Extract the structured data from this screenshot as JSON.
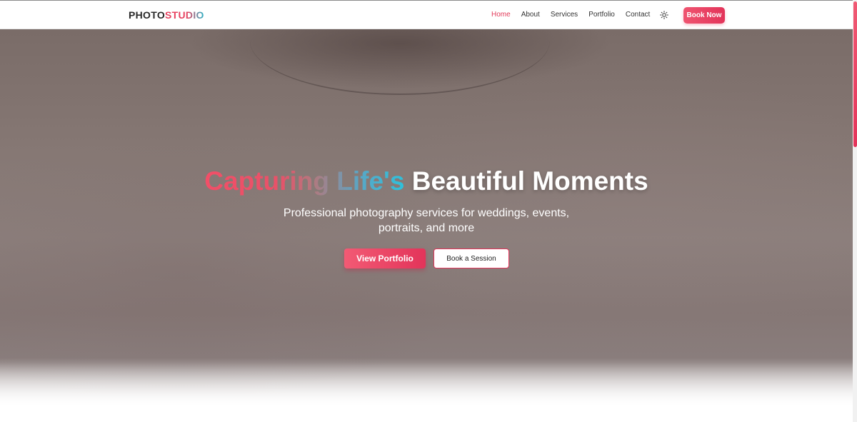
{
  "brand": {
    "logo_part1": "PHOTO",
    "logo_part2": "STUDIO"
  },
  "nav": {
    "links": [
      {
        "label": "Home",
        "active": true
      },
      {
        "label": "About",
        "active": false
      },
      {
        "label": "Services",
        "active": false
      },
      {
        "label": "Portfolio",
        "active": false
      },
      {
        "label": "Contact",
        "active": false
      }
    ],
    "theme_icon": "sun-icon",
    "book_now_label": "Book Now"
  },
  "hero": {
    "headline_gradient": "Capturing Life's",
    "headline_rest": "Beautiful Moments",
    "subtitle_line1": "Professional photography services for weddings, events,",
    "subtitle_line2": "portraits, and more",
    "primary_button": "View Portfolio",
    "secondary_button": "Book a Session"
  },
  "colors": {
    "accent": "#e3345a",
    "accent_light": "#f25a74",
    "teal": "#2ec1db"
  }
}
